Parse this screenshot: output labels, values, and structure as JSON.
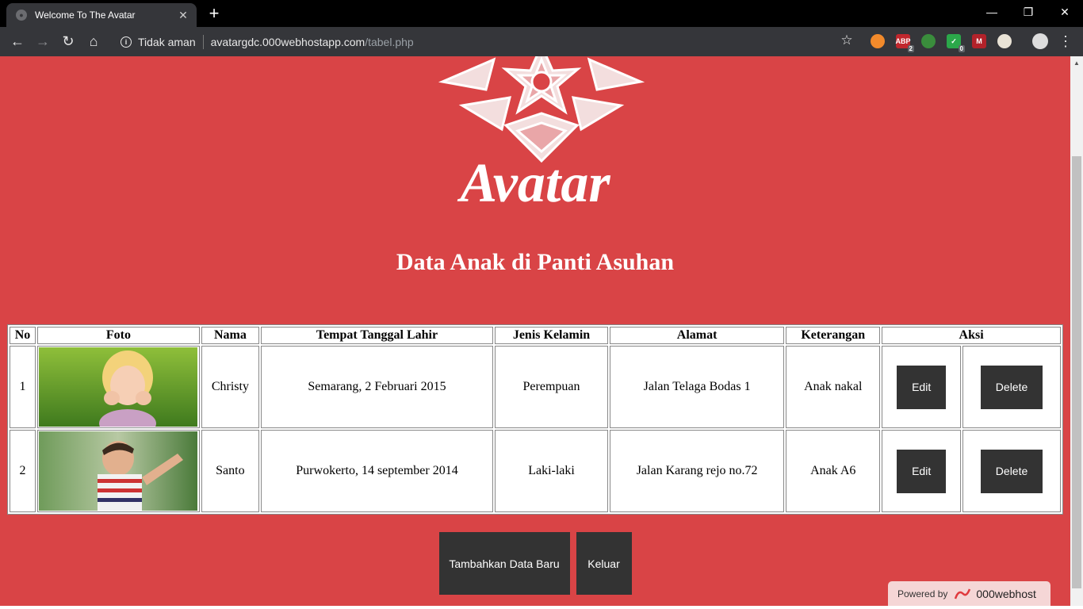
{
  "browser": {
    "tab_title": "Welcome To The Avatar",
    "new_tab_symbol": "+",
    "security_label": "Tidak aman",
    "url_host": "avatargdc.000webhostapp.com",
    "url_path": "/tabel.php",
    "extension_badges": [
      "2",
      "0"
    ]
  },
  "page": {
    "logo_text": "Avatar",
    "title": "Data Anak di Panti Asuhan",
    "table": {
      "headers": [
        "No",
        "Foto",
        "Nama",
        "Tempat Tanggal Lahir",
        "Jenis Kelamin",
        "Alamat",
        "Keterangan",
        "Aksi"
      ],
      "rows": [
        {
          "no": "1",
          "nama": "Christy",
          "ttl": "Semarang, 2 Februari 2015",
          "jk": "Perempuan",
          "alamat": "Jalan Telaga Bodas 1",
          "ket": "Anak nakal"
        },
        {
          "no": "2",
          "nama": "Santo",
          "ttl": "Purwokerto, 14 september 2014",
          "jk": "Laki-laki",
          "alamat": "Jalan Karang rejo no.72",
          "ket": "Anak A6"
        }
      ],
      "edit_label": "Edit",
      "delete_label": "Delete"
    },
    "add_button": "Tambahkan Data Baru",
    "exit_button": "Keluar",
    "powered_by": "Powered by",
    "powered_brand": "000webhost"
  },
  "colors": {
    "page_bg": "#d94446",
    "button_bg": "#333333",
    "chrome_dark": "#35363a"
  }
}
